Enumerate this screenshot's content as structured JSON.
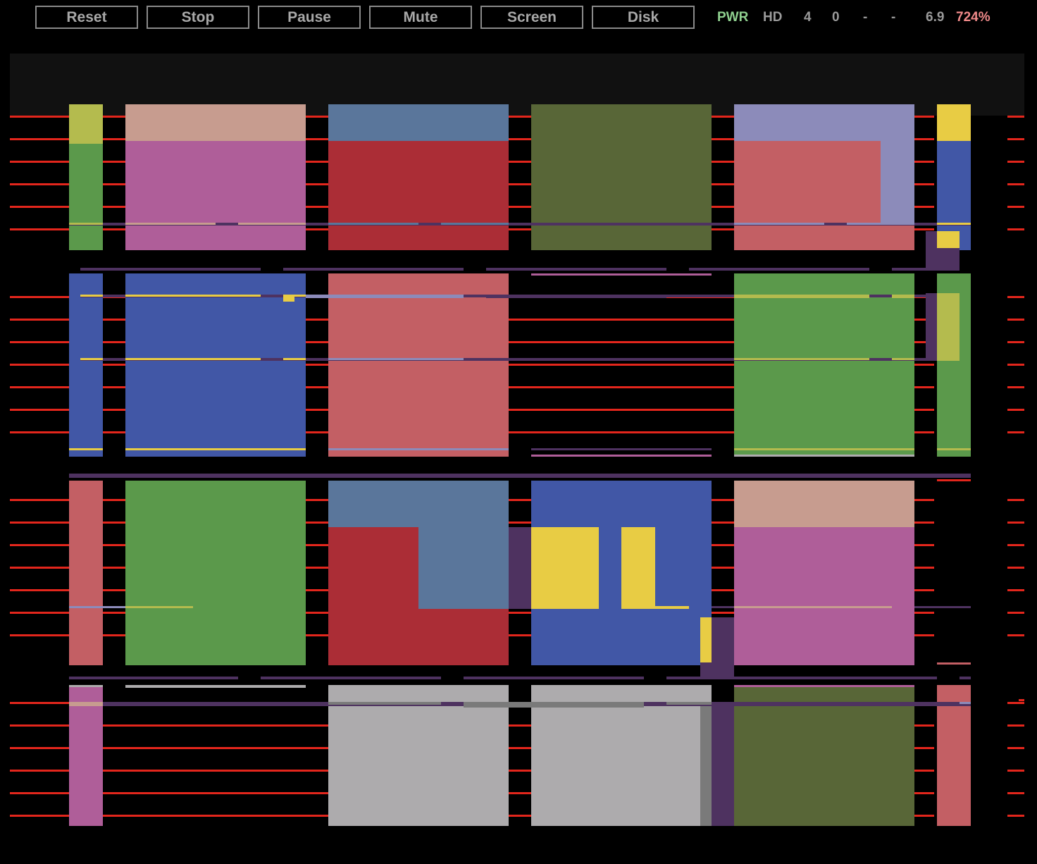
{
  "toolbar": {
    "buttons": [
      {
        "label": "Reset"
      },
      {
        "label": "Stop"
      },
      {
        "label": "Pause"
      },
      {
        "label": "Mute"
      },
      {
        "label": "Screen"
      },
      {
        "label": "Disk"
      }
    ]
  },
  "status": {
    "pwr": "PWR",
    "hd": "HD",
    "d1": "4",
    "d2": "0",
    "d3": "-",
    "d4": "-",
    "mhz": "6.9",
    "speed": "724%",
    "pwr_color": "#8fd08f",
    "speed_color": "#f08a8a"
  },
  "palette": {
    "red_line": "#e3261c",
    "purple": "#4e3260",
    "yellow": "#e8cc44",
    "olive_yellow": "#b4bb4e",
    "green": "#5b994b",
    "tan": "#c79c8f",
    "magenta": "#af5e99",
    "steel": "#5a769b",
    "crimson": "#ab2d36",
    "olive": "#586637",
    "lavender": "#8c8bba",
    "rose": "#c35f64",
    "blue": "#4157a6",
    "gray": "#adabad",
    "dark_gray": "#7a7a7a"
  }
}
